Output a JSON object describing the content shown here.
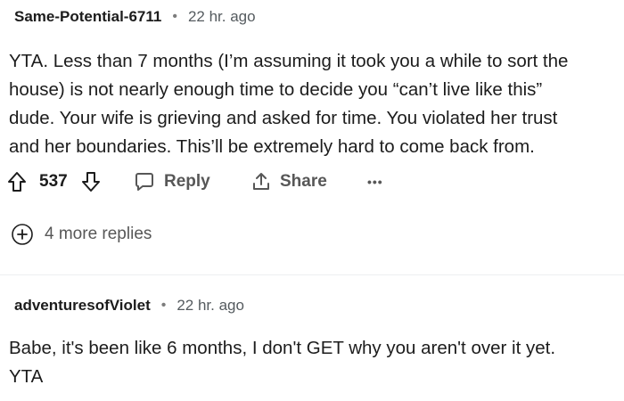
{
  "comments": [
    {
      "username": "Same-Potential-6711",
      "separator": "•",
      "time": "22 hr. ago",
      "body_lines": [
        "YTA. Less than 7 months (I’m assuming it took you a while to sort the",
        "house) is not nearly enough time to decide you “can’t live like this”",
        "dude. Your wife is grieving and asked for time. You violated her trust",
        "and her boundaries. This’ll be extremely hard to come back from."
      ],
      "score": "537",
      "reply_label": "Reply",
      "share_label": "Share",
      "more_label": "•••",
      "more_replies_label": "4 more replies"
    },
    {
      "username": "adventuresofViolet",
      "separator": "•",
      "time": "22 hr. ago",
      "body_lines": [
        "Babe, it's been like 6 months, I don't GET why you aren't over it yet.",
        "YTA"
      ]
    }
  ],
  "icons": {
    "upvote": "arrow-up-outline-icon",
    "downvote": "arrow-down-outline-icon",
    "reply": "comment-bubble-icon",
    "share": "share-upload-icon",
    "more": "ellipsis-icon",
    "expand": "plus-circle-icon"
  },
  "colors": {
    "text": "#1c1c1c",
    "muted": "#575757",
    "meta": "#555b5f",
    "divider": "#edeff1"
  }
}
